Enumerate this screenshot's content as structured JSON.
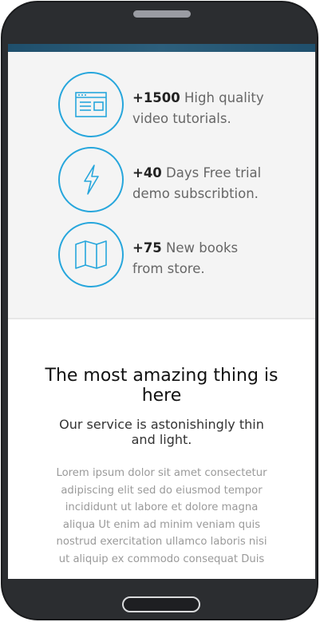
{
  "features": [
    {
      "number": "+1500",
      "text_part1": " High quality",
      "text_part2": "video tutorials.",
      "icon": "browser-window-icon"
    },
    {
      "number": "+40",
      "text_part1": " Days Free trial",
      "text_part2": "demo subscribtion.",
      "icon": "lightning-bolt-icon"
    },
    {
      "number": "+75",
      "text_part1": " New books",
      "text_part2": "from store.",
      "icon": "map-icon"
    }
  ],
  "content": {
    "headline": "The most amazing thing is here",
    "subheadline": "Our service is astonishingly thin and light.",
    "body": "Lorem ipsum dolor sit amet consectetur adipiscing elit sed do eiusmod tempor incididunt ut labore et dolore magna aliqua Ut enim ad minim veniam quis nostrud exercitation ullamco laboris nisi ut aliquip ex commodo consequat Duis"
  },
  "colors": {
    "accent": "#26a6dc",
    "phone_body": "#2b2d30",
    "features_bg": "#f4f4f4",
    "topbar": "#1f4f6c"
  }
}
